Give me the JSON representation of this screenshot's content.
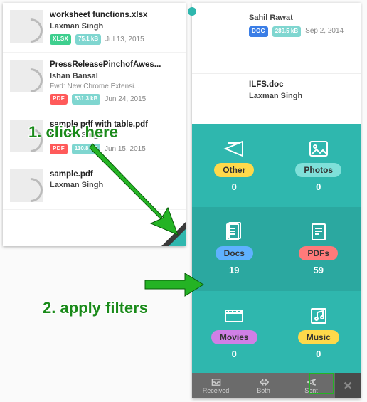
{
  "left_files": [
    {
      "name": "worksheet functions.xlsx",
      "user": "Laxman Singh",
      "subject": "",
      "ext": "XLSX",
      "ext_cls": "xlsx",
      "size": "75.1 kB",
      "date": "Jul 13, 2015"
    },
    {
      "name": "PressReleasePinchofAwes...",
      "user": "Ishan Bansal",
      "subject": "Fwd: New Chrome Extensi...",
      "ext": "PDF",
      "ext_cls": "pdf",
      "size": "531.3 kB",
      "date": "Jun 24, 2015"
    },
    {
      "name": "sample pdf with table.pdf",
      "user": "Laxman Singh",
      "subject": "",
      "ext": "PDF",
      "ext_cls": "pdf",
      "size": "110.8 kB",
      "date": "Jun 15, 2015"
    },
    {
      "name": "sample.pdf",
      "user": "Laxman Singh",
      "subject": "",
      "ext": "",
      "ext_cls": "",
      "size": "",
      "date": ""
    }
  ],
  "right_head": {
    "user": "Sahil Rawat",
    "ext": "DOC",
    "size": "289.5 kB",
    "date": "Sep 2, 2014"
  },
  "right_block": {
    "name": "ILFS.doc",
    "user": "Laxman Singh"
  },
  "filters": [
    {
      "key": "other",
      "label": "Other",
      "count": "0",
      "label_cls": "lab-other",
      "sel": false
    },
    {
      "key": "photos",
      "label": "Photos",
      "count": "0",
      "label_cls": "lab-photos",
      "sel": false
    },
    {
      "key": "docs",
      "label": "Docs",
      "count": "19",
      "label_cls": "lab-docs",
      "sel": true
    },
    {
      "key": "pdfs",
      "label": "PDFs",
      "count": "59",
      "label_cls": "lab-pdfs",
      "sel": true
    },
    {
      "key": "movies",
      "label": "Movies",
      "count": "0",
      "label_cls": "lab-movies",
      "sel": false
    },
    {
      "key": "music",
      "label": "Music",
      "count": "0",
      "label_cls": "lab-music",
      "sel": false
    }
  ],
  "bottom": {
    "received": "Received",
    "both": "Both",
    "sent": "Sent"
  },
  "annotations": {
    "a1": "1. click here",
    "a2": "2. apply filters"
  }
}
